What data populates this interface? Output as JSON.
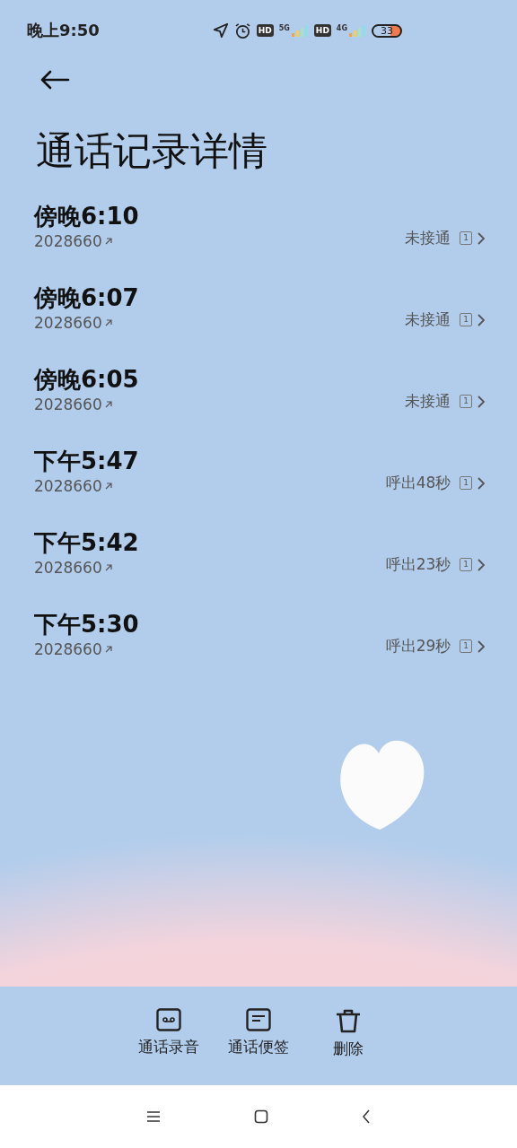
{
  "status_bar": {
    "time": "晚上9:50",
    "hd_1": "HD",
    "network_1": "5G",
    "hd_2": "HD",
    "network_2": "4G",
    "battery": "33"
  },
  "title": "通话记录详情",
  "calls": [
    {
      "time": "傍晚6:10",
      "number": "2028660",
      "result": "未接通",
      "sim": "1"
    },
    {
      "time": "傍晚6:07",
      "number": "2028660",
      "result": "未接通",
      "sim": "1"
    },
    {
      "time": "傍晚6:05",
      "number": "2028660",
      "result": "未接通",
      "sim": "1"
    },
    {
      "time": "下午5:47",
      "number": "2028660",
      "result": "呼出48秒",
      "sim": "1"
    },
    {
      "time": "下午5:42",
      "number": "2028660",
      "result": "呼出23秒",
      "sim": "1"
    },
    {
      "time": "下午5:30",
      "number": "2028660",
      "result": "呼出29秒",
      "sim": "1"
    }
  ],
  "actions": [
    {
      "kind": "recording",
      "label": "通话录音"
    },
    {
      "kind": "note",
      "label": "通话便签"
    },
    {
      "kind": "delete",
      "label": "删除"
    }
  ]
}
